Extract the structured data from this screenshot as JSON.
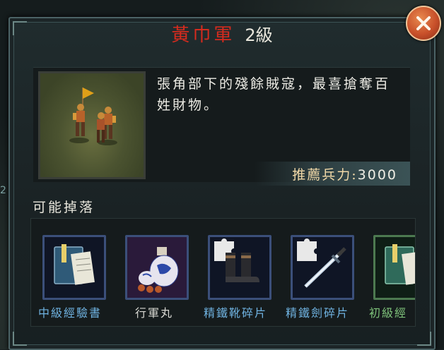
{
  "unit": {
    "name": "黃巾軍",
    "level": "2級",
    "description": "張角部下的殘餘賊寇，最喜搶奪百姓財物。",
    "recommended_power_label": "推薦兵力:",
    "recommended_power_value": "3000"
  },
  "drops": {
    "title": "可能掉落",
    "items": [
      {
        "label": "中級經驗書",
        "icon": "book-icon",
        "rarity_color": "#6fb2e0"
      },
      {
        "label": "行軍丸",
        "icon": "medicine-jar-icon",
        "rarity_color": "#d8d8d2"
      },
      {
        "label": "精鐵靴碎片",
        "icon": "boots-fragment-icon",
        "rarity_color": "#6fb2e0"
      },
      {
        "label": "精鐵劍碎片",
        "icon": "sword-fragment-icon",
        "rarity_color": "#6fb2e0"
      },
      {
        "label": "初級經",
        "icon": "book-icon",
        "rarity_color": "#7ec27a"
      }
    ]
  },
  "colors": {
    "title_red": "#d42b1e",
    "close_orange": "#c8502a"
  }
}
